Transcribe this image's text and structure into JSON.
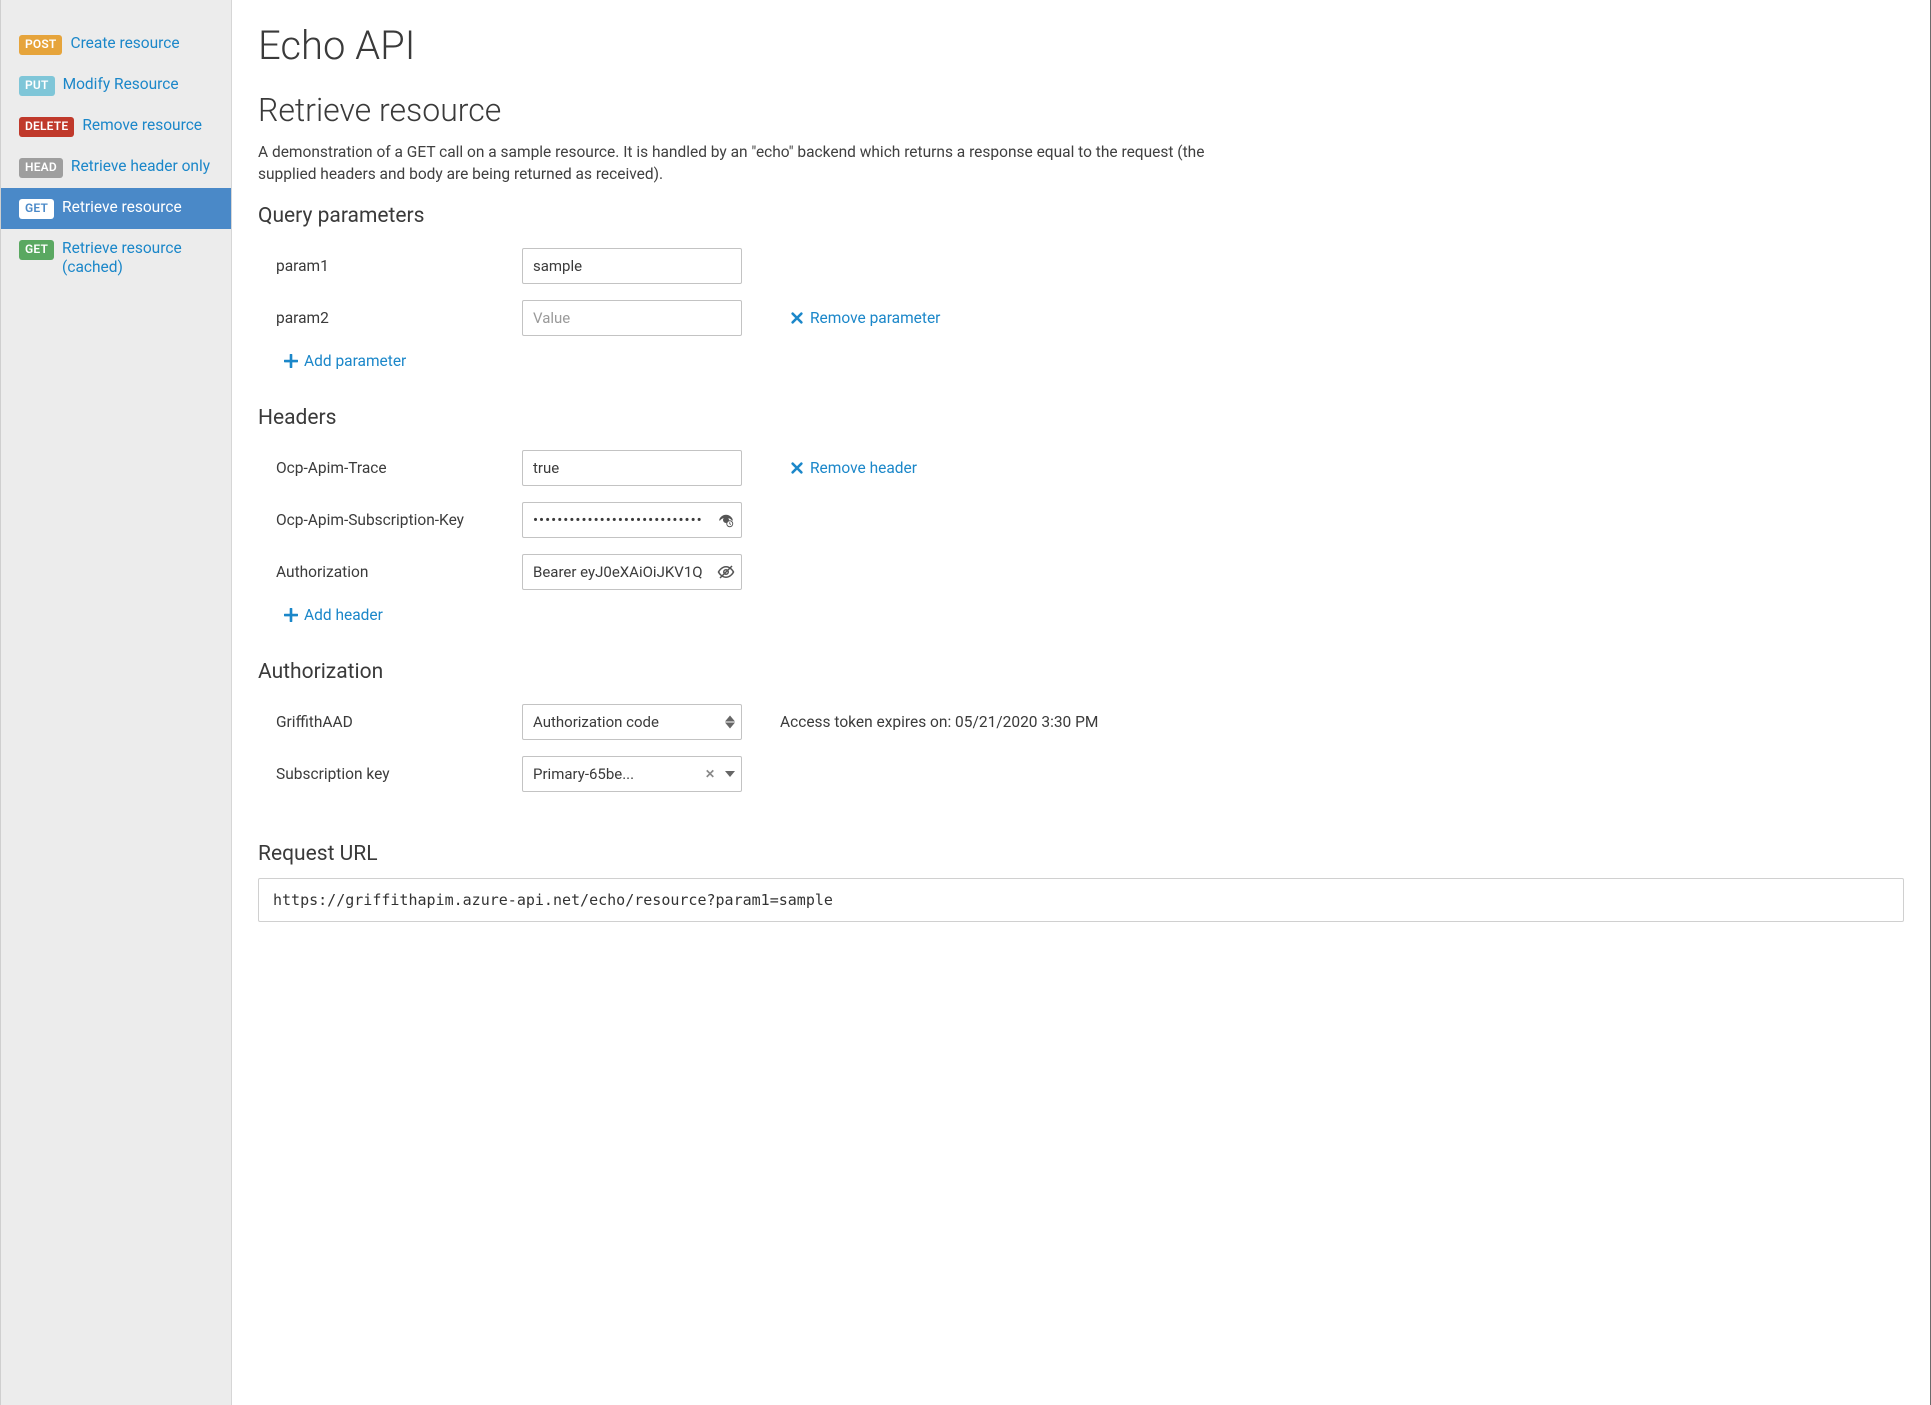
{
  "api_title": "Echo API",
  "operation": {
    "title": "Retrieve resource",
    "description": "A demonstration of a GET call on a sample resource. It is handled by an \"echo\" backend which returns a response equal to the request (the supplied headers and body are being returned as received)."
  },
  "sidebar": {
    "items": [
      {
        "method": "POST",
        "label": "Create resource",
        "active": false
      },
      {
        "method": "PUT",
        "label": "Modify Resource",
        "active": false
      },
      {
        "method": "DELETE",
        "label": "Remove resource",
        "active": false
      },
      {
        "method": "HEAD",
        "label": "Retrieve header only",
        "active": false
      },
      {
        "method": "GET",
        "label": "Retrieve resource",
        "active": true
      },
      {
        "method": "GET",
        "label": "Retrieve resource (cached)",
        "active": false
      }
    ]
  },
  "sections": {
    "query_title": "Query parameters",
    "headers_title": "Headers",
    "auth_title": "Authorization",
    "url_title": "Request URL"
  },
  "query_params": [
    {
      "name": "param1",
      "value": "sample",
      "placeholder": "",
      "removable": false
    },
    {
      "name": "param2",
      "value": "",
      "placeholder": "Value",
      "removable": true
    }
  ],
  "query_actions": {
    "add_label": "Add parameter",
    "remove_label": "Remove parameter"
  },
  "headers": [
    {
      "name": "Ocp-Apim-Trace",
      "value": "true",
      "masked": false,
      "icon": "none",
      "removable": true
    },
    {
      "name": "Ocp-Apim-Subscription-Key",
      "value": "••••••••••••••••••••••••••••",
      "masked": true,
      "icon": "reveal",
      "removable": false
    },
    {
      "name": "Authorization",
      "value": "Bearer eyJ0eXAiOiJKV1Q",
      "masked": false,
      "icon": "eye",
      "removable": false
    }
  ],
  "header_actions": {
    "add_label": "Add header",
    "remove_label": "Remove header"
  },
  "authorization": {
    "server_label": "GriffithAAD",
    "server_select": "Authorization code",
    "expiry_text": "Access token expires on: 05/21/2020 3:30 PM",
    "subkey_label": "Subscription key",
    "subkey_select": "Primary-65be..."
  },
  "request_url": "https://griffithapim.azure-api.net/echo/resource?param1=sample"
}
